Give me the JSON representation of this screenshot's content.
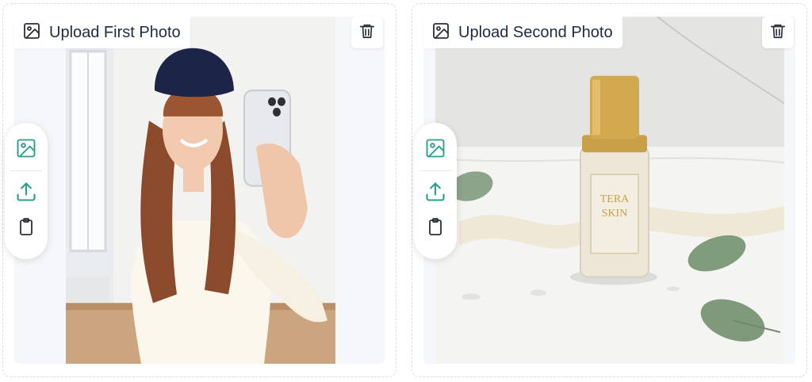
{
  "panels": [
    {
      "label": "Upload First Photo",
      "icons": {
        "label": "image-icon",
        "delete": "trash-icon",
        "gallery": "image-icon",
        "upload": "upload-icon",
        "paste": "clipboard-icon"
      }
    },
    {
      "label": "Upload Second Photo",
      "icons": {
        "label": "image-icon",
        "delete": "trash-icon",
        "gallery": "image-icon",
        "upload": "upload-icon",
        "paste": "clipboard-icon"
      }
    }
  ],
  "product": {
    "brand_line1": "TERA",
    "brand_line2": "SKIN"
  },
  "colors": {
    "accent": "#2a9d8f",
    "text": "#1f2a44",
    "icon_dark": "#2b2f36",
    "border": "#d9dde3"
  }
}
